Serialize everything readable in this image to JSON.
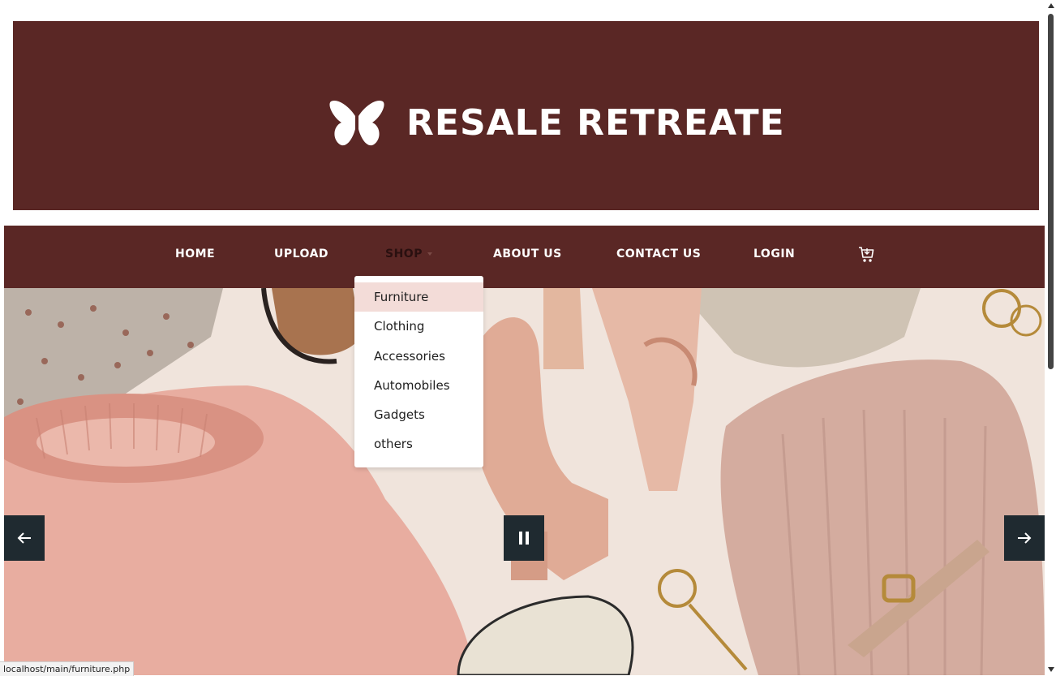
{
  "header": {
    "brand": "RESALE RETREATE",
    "logo_icon": "butterfly-icon"
  },
  "nav": {
    "items": [
      {
        "label": "HOME"
      },
      {
        "label": "UPLOAD"
      },
      {
        "label": "SHOP"
      },
      {
        "label": "ABOUT US"
      },
      {
        "label": "CONTACT US"
      },
      {
        "label": "LOGIN"
      }
    ],
    "cart_icon": "cart-icon"
  },
  "shop_dropdown": {
    "items": [
      {
        "label": "Furniture"
      },
      {
        "label": "Clothing"
      },
      {
        "label": "Accessories"
      },
      {
        "label": "Automobiles"
      },
      {
        "label": "Gadgets"
      },
      {
        "label": "others"
      }
    ],
    "highlighted": "Furniture"
  },
  "carousel": {
    "prev_icon": "arrow-left-icon",
    "pause_icon": "pause-icon",
    "next_icon": "arrow-right-icon"
  },
  "status_bar": {
    "url": "localhost/main/furniture.php"
  },
  "colors": {
    "brand": "#5a2725",
    "nav_text": "#ffffff",
    "dropdown_highlight": "#f3dcd8",
    "carousel_control": "#1f2a30"
  }
}
